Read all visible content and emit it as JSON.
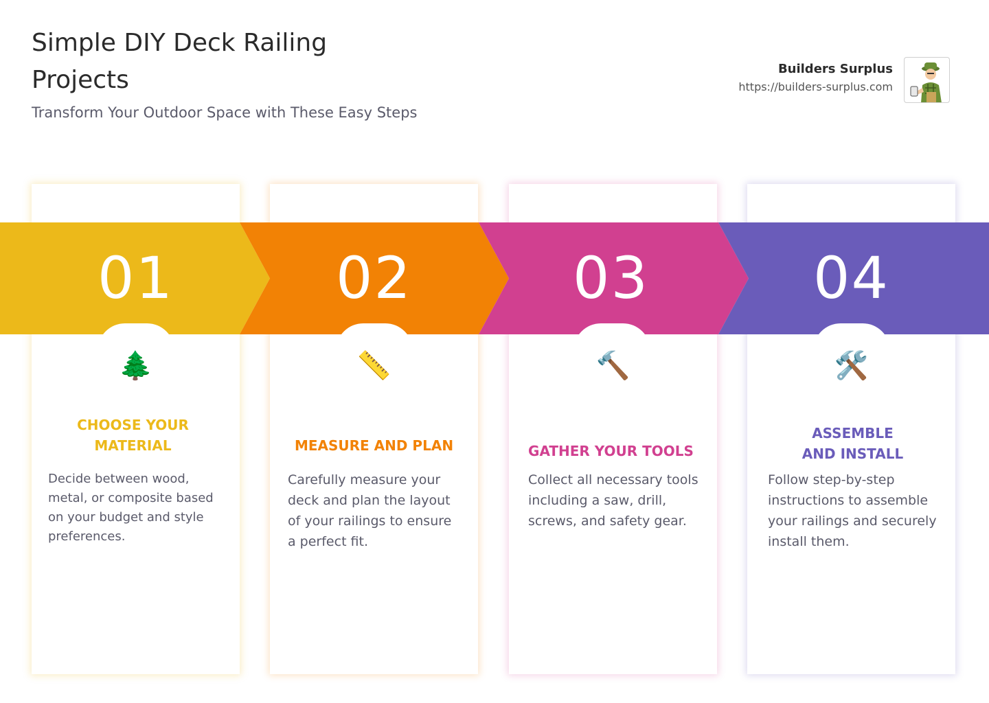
{
  "header": {
    "title": "Simple DIY Deck Railing Projects",
    "subtitle": "Transform Your Outdoor Space with These Easy Steps"
  },
  "brand": {
    "name": "Builders Surplus",
    "url": "https://builders-surplus.com",
    "logo_icon": "builder-mascot-icon"
  },
  "steps": [
    {
      "number": "01",
      "icon": "🌲",
      "icon_name": "evergreen-tree-icon",
      "heading": "CHOOSE YOUR MATERIAL",
      "description": "Decide between wood, metal, or composite based on your budget and style preferences.",
      "color": "#ECB91A"
    },
    {
      "number": "02",
      "icon": "📏",
      "icon_name": "ruler-icon",
      "heading": "MEASURE AND PLAN",
      "description": "Carefully measure your deck and plan the layout of your railings to ensure a perfect fit.",
      "color": "#F28205"
    },
    {
      "number": "03",
      "icon": "🔨",
      "icon_name": "hammer-icon",
      "heading": "GATHER YOUR TOOLS",
      "description": "Collect all necessary tools including a saw, drill, screws, and safety gear.",
      "color": "#D14090"
    },
    {
      "number": "04",
      "icon": "🛠️",
      "icon_name": "hammer-and-wrench-icon",
      "heading": "ASSEMBLE AND INSTALL",
      "description": "Follow step-by-step instructions to assemble your railings and securely install them.",
      "color": "#6A5CBA"
    }
  ]
}
